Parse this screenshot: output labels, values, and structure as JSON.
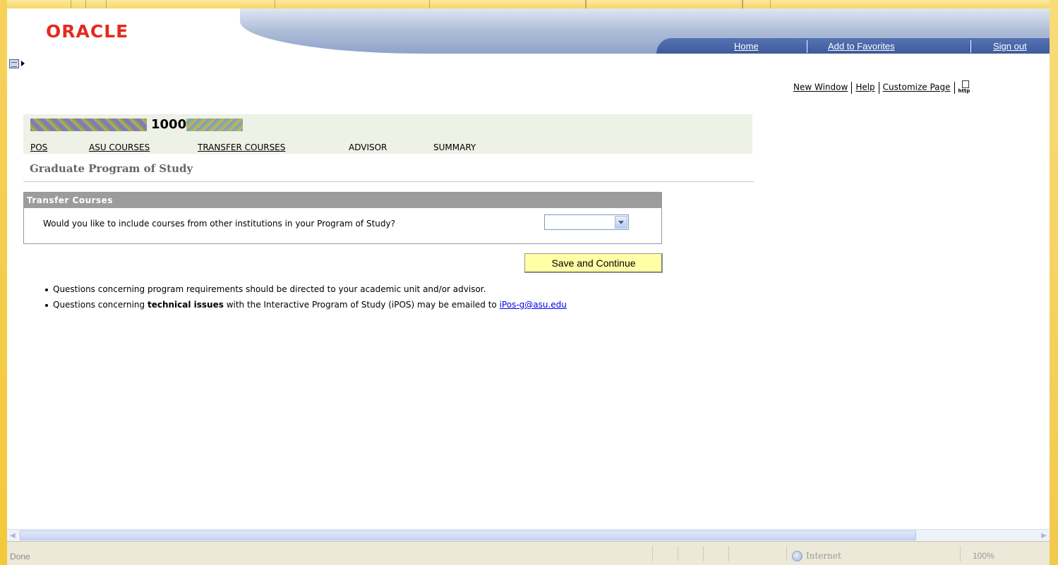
{
  "header": {
    "logo": "ORACLE",
    "links": [
      {
        "label": "Home"
      },
      {
        "label": "Add to Favorites"
      },
      {
        "label": "Sign out"
      }
    ]
  },
  "page_links": {
    "new_window": "New Window",
    "help": "Help",
    "customize": "Customize Page",
    "http_icon_text": "http"
  },
  "student": {
    "id_visible": "1000"
  },
  "tabs": [
    {
      "label": "POS",
      "link": true
    },
    {
      "label": "ASU COURSES",
      "link": true
    },
    {
      "label": "TRANSFER COURSES",
      "link": true
    },
    {
      "label": "ADVISOR",
      "link": false
    },
    {
      "label": "SUMMARY",
      "link": false
    }
  ],
  "page_title": "Graduate Program of Study",
  "transfer": {
    "header": "Transfer Courses",
    "question": "Would you like to include courses from other institutions in your Program of Study?",
    "select_value": ""
  },
  "save_button": "Save and Continue",
  "notes": {
    "line1": "Questions concerning program requirements should be directed to your academic unit and/or advisor.",
    "line2_pre": "Questions concerning ",
    "line2_bold": "technical issues",
    "line2_mid": " with the Interactive Program of Study (iPOS) may be emailed to ",
    "line2_link": "iPos-g@asu.edu"
  },
  "statusbar": {
    "status": "Done",
    "zone": "Internet",
    "zoom": "100%"
  },
  "colors": {
    "oracle_red": "#e32b1f",
    "nav_blue": "#3e5a9d",
    "button_yellow": "#ffffa6",
    "section_gray": "#9c9c9c"
  }
}
